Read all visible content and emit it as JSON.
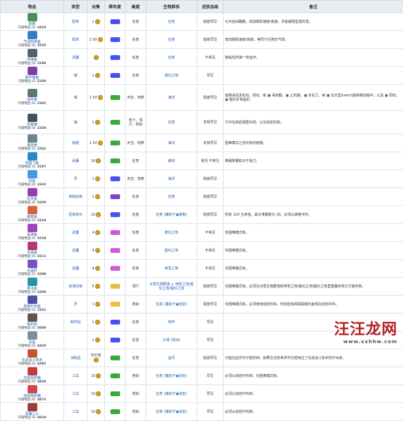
{
  "columns": {
    "item": "物品",
    "type": "类型",
    "price": "出售",
    "rarity": "稀有度",
    "height": "高度",
    "biome": "生物群系",
    "unlock": "进获品级",
    "note": "备注"
  },
  "id_prefix": "内部物品 ID:",
  "rows": [
    {
      "name": "软鞭",
      "id": "2423",
      "type": "配饰",
      "price": "1",
      "rarity_color": "#4b4ff0",
      "height": "任意",
      "biome": "任意",
      "unlock": "极度罕见",
      "note": "允许自由翻跳，增加跳跃速度/高度，并能缓慢坠落伤害。"
    },
    {
      "name": "气球双束鱼",
      "id": "3225",
      "type": "配饰",
      "price": "2 50",
      "rarity_color": "#4b4ff0",
      "height": "任意",
      "biome": "任意",
      "unlock": "极度罕见",
      "note": "增加跳跃速度/高度，等同于闪亮红气球。"
    },
    {
      "name": "炸弹鱼",
      "id": "3196",
      "type": "武器",
      "price": "",
      "rarity_color": "#4b4ff0",
      "height": "任意",
      "biome": "任意",
      "unlock": "不常见",
      "note": "像粘性炸弹一样运作。"
    },
    {
      "name": "紫环锤鱼",
      "id": "2330",
      "type": "锤",
      "price": "1",
      "rarity_color": "#4b4ff0",
      "height": "任意",
      "biome": "腐化之地",
      "unlock": "罕见",
      "note": ""
    },
    {
      "name": "掠夺者",
      "id": "2341",
      "type": "镐",
      "price": "1 50",
      "rarity_color": "#3aa83a",
      "height": "天空、地表",
      "biome": "海洋",
      "unlock": "极度罕见",
      "note": "能够采挖泥化石、陨石、和 ▣ 毒刺酸、▣ 土机猴、▣ 赤玄兰、和 ▣ 在天堂Switch版和移动版中，以及 ▣ 阳石、▣ 猩红矿和晶矿。"
    },
    {
      "name": "岩鱼锤",
      "id": "2320",
      "type": "锤",
      "price": "1",
      "rarity_color": "#3aa83a",
      "height": "地下、洞穴、地狱",
      "biome": "任意",
      "unlock": "非常罕见",
      "note": "只可在熔岩湖里出现、以及熔岩钓获。"
    },
    {
      "name": "锯齿鱼",
      "id": "2341",
      "type": "链锯",
      "price": "1 50",
      "rarity_color": "#3aa83a",
      "height": "天空、地表",
      "biome": "海洋",
      "unlock": "非常罕见",
      "note": "困难模式之前仅有的链锯。"
    },
    {
      "name": "草图飞鱼",
      "id": "3197",
      "type": "武器",
      "price": "16",
      "rarity_color": "#3aa83a",
      "height": "任意",
      "biome": "森林",
      "unlock": "常见 不常见",
      "note": "降霜数量取决于渔力。"
    },
    {
      "name": "剑鱼",
      "id": "2332",
      "type": "矛",
      "price": "1",
      "rarity_color": "#4b4ff0",
      "height": "天空、地表",
      "biome": "海洋",
      "unlock": "极度罕见",
      "note": ""
    },
    {
      "name": "虹风鱼",
      "id": "2420",
      "type": "宠物召唤",
      "price": "1",
      "rarity_color": "#8a3ec8",
      "height": "任意",
      "biome": "任意",
      "unlock": "极度罕见",
      "note": ""
    },
    {
      "name": "蜂蜜鱼",
      "id": "2314",
      "type": "回复药水",
      "price": "15",
      "rarity_color": "#4b4ff0",
      "height": "任意",
      "biome": "任意 (捕获于▣蜂蜜)",
      "unlock": "极度罕见",
      "note": "恢复 120 生命值，最大堆叠数为 30。必须从蜂蜜中钓。"
    },
    {
      "name": "毒弹鱼",
      "id": "3210",
      "type": "武器",
      "price": "4",
      "rarity_color": "#d05ad8",
      "height": "任意",
      "biome": "腐化之地",
      "unlock": "不常见",
      "note": "仅困难模式有。"
    },
    {
      "name": "当语鱼",
      "id": "3211",
      "type": "武器",
      "price": "4",
      "rarity_color": "#d05ad8",
      "height": "任意",
      "biome": "猩红之地",
      "unlock": "不常见",
      "note": "仅困难模式有。"
    },
    {
      "name": "水晶虾",
      "id": "3209",
      "type": "武器",
      "price": "4",
      "rarity_color": "#d05ad8",
      "height": "任意",
      "biome": "神圣之地",
      "unlock": "不常见",
      "note": "仅困难模式有。"
    },
    {
      "name": "果冻鱼",
      "id": "2430",
      "type": "坐骑召唤",
      "price": "5",
      "rarity_color": "#e6c23a",
      "height": "洞穴",
      "biome": "冰雪生物群落 + 神圣之地/腐化之地/猩红之地",
      "unlock": "极度罕见",
      "note": "仅困难模式有。必须在冰雪生物群落和神圣之地/腐化之地/猩红之地里重叠的地方才能钓到。"
    },
    {
      "name": "黑曜石剑鱼",
      "id": "2331",
      "type": "矛",
      "price": "1",
      "rarity_color": "#e6c23a",
      "height": "地狱",
      "biome": "任意 (捕获于▣熔岩)",
      "unlock": "极度罕见",
      "note": "仅困难模式有。必须使用熔岩钓钩、钓熔岩渔网或黑曜石鱼饵在熔岩中钓。"
    },
    {
      "name": "炼药桌",
      "id": "5000",
      "type": "制作站",
      "price": "1",
      "rarity_color": "#4b4ff0",
      "height": "任意",
      "biome": "地牢",
      "unlock": "罕见",
      "note": ""
    },
    {
      "name": "冻鱼",
      "id": "4410",
      "type": "",
      "price": "1",
      "rarity_color": "#4b4ff0",
      "height": "任意",
      "biome": "沙漠 (绿洲)",
      "unlock": "罕见",
      "note": ""
    },
    {
      "name": "先进战斗技术",
      "id": "4382",
      "type": "消耗品",
      "price": "无价值",
      "rarity_color": "#3aa83a",
      "height": "任意",
      "biome": "血月",
      "unlock": "极度罕见",
      "note": "只能在血月中才能钓到。如果在当前世界中已经用过了先进战斗技术则不出来。"
    },
    {
      "name": "无底熔岩桶",
      "id": "4820",
      "type": "工具",
      "price": "10",
      "rarity_color": "#3aa83a",
      "height": "地狱",
      "biome": "任意 (捕获于▣熔岩)",
      "unlock": "罕见",
      "note": "必须从熔岩中钓到。仅困难模式有。"
    },
    {
      "name": "熔岩吸收桶",
      "id": "4872",
      "type": "工具",
      "price": "10",
      "rarity_color": "#3aa83a",
      "height": "地狱",
      "biome": "任意 (捕获于▣熔岩)",
      "unlock": "罕见",
      "note": "必须从熔岩中钓到。"
    },
    {
      "name": "恶魔之心",
      "id": "4819",
      "type": "工具",
      "price": "10",
      "rarity_color": "#3aa83a",
      "height": "地狱",
      "biome": "任意 (捕获于▣熔岩)",
      "unlock": "罕见",
      "note": "必须从熔岩中钓到。"
    }
  ],
  "watermark": {
    "title": "汪汪龙网",
    "sub": "www.xxhhw.com"
  }
}
